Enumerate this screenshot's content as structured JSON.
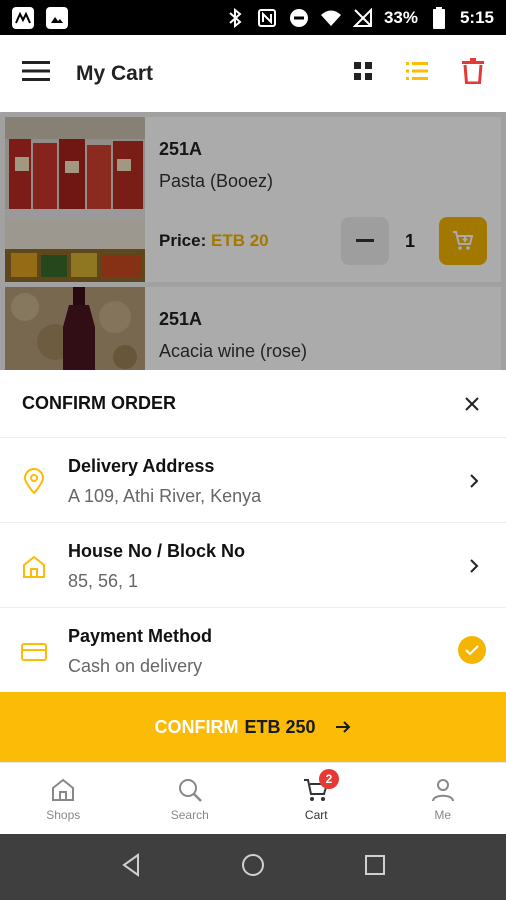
{
  "status_bar": {
    "battery": "33%",
    "time": "5:15"
  },
  "app_bar": {
    "title": "My Cart"
  },
  "products": [
    {
      "code": "251A",
      "name": "Pasta (Booez)",
      "price_label": "Price:",
      "price": "ETB 20",
      "quantity": "1"
    },
    {
      "code": "251A",
      "name": "Acacia wine (rose)"
    }
  ],
  "sheet": {
    "title": "CONFIRM ORDER",
    "rows": [
      {
        "label": "Delivery Address",
        "value": "A 109, Athi River, Kenya",
        "icon": "location-pin-icon"
      },
      {
        "label": "House No / Block No",
        "value": "85, 56, 1",
        "icon": "home-icon"
      },
      {
        "label": "Payment Method",
        "value": "Cash on delivery",
        "icon": "credit-card-icon"
      }
    ],
    "confirm": {
      "label": "CONFIRM",
      "amount": "ETB 250"
    }
  },
  "bottom_nav": {
    "items": [
      {
        "label": "Shops",
        "icon": "shop-icon"
      },
      {
        "label": "Search",
        "icon": "search-icon"
      },
      {
        "label": "Cart",
        "icon": "cart-icon",
        "badge": "2"
      },
      {
        "label": "Me",
        "icon": "person-icon"
      }
    ]
  },
  "colors": {
    "accent": "#fbbb06",
    "danger": "#e53935",
    "text": "#1a1a1a"
  }
}
